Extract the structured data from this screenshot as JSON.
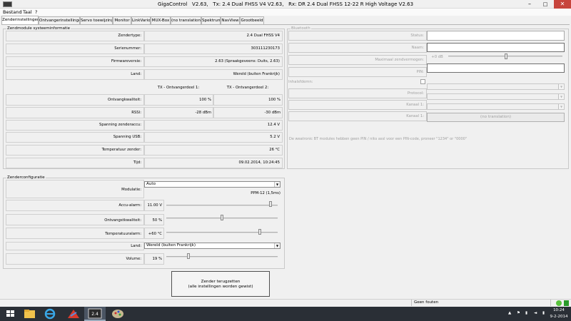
{
  "window": {
    "title": "GigaControl   V2.63,   Tx: 2.4 Dual FHSS V4 V2.63,   Rx: DR 2.4 Dual FHSS 12-22 R High Voltage V2.63",
    "minimize": "–",
    "maximize": "□",
    "close": "✕"
  },
  "menu": [
    "Bestand",
    "Taal",
    "?"
  ],
  "tabs": [
    "Zenderinstellingen",
    "Ontvangerinstellingen",
    "Servo toewijzing",
    "Monitor",
    "LinkVario",
    "MUX-Box",
    "(no translation)",
    "Spektrum",
    "NavView",
    "Grootbeeld"
  ],
  "transmitter_info": {
    "group_title": "Zendmodule systeeminformatie",
    "rows": [
      {
        "label": "Zendertype:",
        "value": "2.4 Dual FHSS V4"
      },
      {
        "label": "Serienummer:",
        "value": "303111230173"
      },
      {
        "label": "Firmwareversie:",
        "value": "2.63 (Spraakgeveens: Duits, 2.63)"
      },
      {
        "label": "Land:",
        "value": "Wereld (buiten Frankrijk)"
      }
    ],
    "col_headers": [
      "TX - Ontvangerdeel 1:",
      "TX - Ontvangerdeel 2:"
    ],
    "dual_rows": [
      {
        "label": "Ontvangkwaliteit:",
        "v1": "100 %",
        "v2": "100 %"
      },
      {
        "label": "RSSI:",
        "v1": "-28 dBm",
        "v2": "-30 dBm"
      }
    ],
    "rows2": [
      {
        "label": "Spanning zenderaccu:",
        "value": "12.4 V"
      },
      {
        "label": "Spanning USB:",
        "value": "5.2 V"
      },
      {
        "label": "Temperatuur zender:",
        "value": "26 °C"
      },
      {
        "label": "Tijd:",
        "value": "09.02.2014, 10:24:45"
      }
    ]
  },
  "bluetooth": {
    "group_title": "Bluetooth",
    "status_label": "Status:",
    "name_label": "Naam:",
    "max_power_label": "Maximaal zendvermogen:",
    "max_power_value": "+0 dB",
    "pin_label": "PIN:",
    "enable_label": "Inhalsfdemn:",
    "protocol_label": "Protocol:",
    "channel1_label": "Kanaal 1:",
    "channel2_label": "Kanaal 1:",
    "button_label": "(no translation)",
    "note": "De weatronic BT modules hebben geen PIN / niks assl voor een PIN-code, proneer \"1234\" or \"0000\""
  },
  "transmitter_config": {
    "group_title": "Zenderconfiguratie",
    "modulation_label": "Modulatie:",
    "modulation_value": "Auto",
    "modulation_info": "PPM-12 (1,5ms)",
    "battery_alarm_label": "Accu-alarm:",
    "battery_alarm_value": "11.00 V",
    "battery_alarm_level": 0.95,
    "reception_quality_label": "Ontvangstkwaliteit:",
    "reception_quality_value": "50 %",
    "reception_quality_level": 0.5,
    "temp_alarm_label": "Temperatuuralarm:",
    "temp_alarm_value": "+60 °C",
    "temp_alarm_level": 0.85,
    "country_label": "Land:",
    "country_value": "Wereld (buiten Frankrijk)",
    "volume_label": "Volume:",
    "volume_value": "19 %",
    "volume_level": 0.19
  },
  "reset_button": {
    "line1": "Zender terugzetten",
    "line2": "(alle instellingen worden gewist)"
  },
  "statusbar": {
    "text": "Geen fouten"
  },
  "taskbar": {
    "time": "10:24",
    "date": "9-2-2014",
    "items": [
      "start-button",
      "file-explorer",
      "internet-explorer",
      "app-red",
      "gigacontrol",
      "app-paint"
    ]
  }
}
